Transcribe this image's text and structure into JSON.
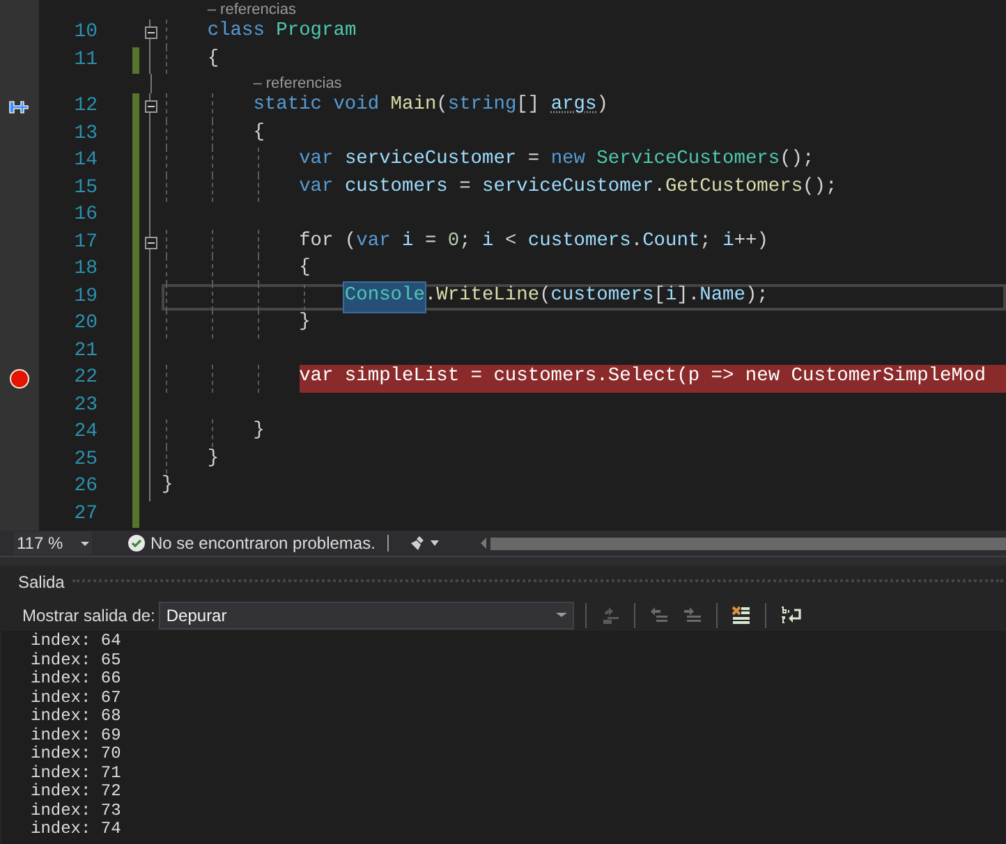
{
  "editor": {
    "lines": [
      {
        "number": "10",
        "lens": "– referencias",
        "fold": true,
        "changed": false,
        "bookmark": false,
        "breakpoint": false,
        "current": false,
        "tokens": [
          {
            "text": "    class ",
            "kind": "keyword"
          },
          {
            "text": "Program",
            "kind": "type"
          }
        ]
      },
      {
        "number": "11",
        "fold": false,
        "changed": true,
        "bookmark": false,
        "breakpoint": false,
        "current": false,
        "tokens": [
          {
            "text": "    {",
            "kind": "plain"
          }
        ]
      },
      {
        "number": "12",
        "lens": "– referencias",
        "fold": true,
        "changed": true,
        "bookmark": true,
        "breakpoint": false,
        "current": false,
        "tokens": [
          {
            "text": "        static void ",
            "kind": "keyword"
          },
          {
            "text": "Main",
            "kind": "method"
          },
          {
            "text": "(",
            "kind": "plain"
          },
          {
            "text": "string",
            "kind": "keyword"
          },
          {
            "text": "[] ",
            "kind": "plain"
          },
          {
            "text": "args",
            "kind": "unused"
          },
          {
            "text": ")",
            "kind": "plain"
          }
        ]
      },
      {
        "number": "13",
        "fold": false,
        "changed": true,
        "bookmark": false,
        "breakpoint": false,
        "current": false,
        "tokens": [
          {
            "text": "        {",
            "kind": "plain"
          }
        ]
      },
      {
        "number": "14",
        "fold": false,
        "changed": true,
        "bookmark": false,
        "breakpoint": false,
        "current": false,
        "tokens": [
          {
            "text": "            var ",
            "kind": "keyword"
          },
          {
            "text": "serviceCustomer",
            "kind": "variable"
          },
          {
            "text": " = ",
            "kind": "plain"
          },
          {
            "text": "new ",
            "kind": "keyword"
          },
          {
            "text": "ServiceCustomers",
            "kind": "type"
          },
          {
            "text": "();",
            "kind": "plain"
          }
        ]
      },
      {
        "number": "15",
        "fold": false,
        "changed": true,
        "bookmark": false,
        "breakpoint": false,
        "current": false,
        "tokens": [
          {
            "text": "            var ",
            "kind": "keyword"
          },
          {
            "text": "customers",
            "kind": "variable"
          },
          {
            "text": " = ",
            "kind": "plain"
          },
          {
            "text": "serviceCustomer",
            "kind": "variable"
          },
          {
            "text": ".",
            "kind": "plain"
          },
          {
            "text": "GetCustomers",
            "kind": "method"
          },
          {
            "text": "();",
            "kind": "plain"
          }
        ]
      },
      {
        "number": "16",
        "fold": false,
        "changed": true,
        "bookmark": false,
        "breakpoint": false,
        "current": false
      },
      {
        "number": "17",
        "fold": true,
        "changed": true,
        "bookmark": false,
        "breakpoint": false,
        "current": false,
        "tokens": [
          {
            "text": "            for (",
            "kind": "plain"
          },
          {
            "text": "var ",
            "kind": "keyword"
          },
          {
            "text": "i",
            "kind": "variable"
          },
          {
            "text": " = ",
            "kind": "plain"
          },
          {
            "text": "0",
            "kind": "number"
          },
          {
            "text": "; ",
            "kind": "plain"
          },
          {
            "text": "i",
            "kind": "variable"
          },
          {
            "text": " < ",
            "kind": "plain"
          },
          {
            "text": "customers",
            "kind": "variable"
          },
          {
            "text": ".",
            "kind": "plain"
          },
          {
            "text": "Count",
            "kind": "variable"
          },
          {
            "text": "; ",
            "kind": "plain"
          },
          {
            "text": "i",
            "kind": "variable"
          },
          {
            "text": "++)",
            "kind": "plain"
          }
        ]
      },
      {
        "number": "18",
        "fold": false,
        "changed": true,
        "bookmark": false,
        "breakpoint": false,
        "current": false,
        "tokens": [
          {
            "text": "            {",
            "kind": "plain"
          }
        ]
      },
      {
        "number": "19",
        "fold": false,
        "changed": true,
        "bookmark": false,
        "breakpoint": false,
        "current": true,
        "tokens": [
          {
            "text": "                Console",
            "kind": "selected-type"
          },
          {
            "text": ".",
            "kind": "plain"
          },
          {
            "text": "WriteLine",
            "kind": "method"
          },
          {
            "text": "(",
            "kind": "plain"
          },
          {
            "text": "customers",
            "kind": "variable"
          },
          {
            "text": "[",
            "kind": "plain"
          },
          {
            "text": "i",
            "kind": "variable"
          },
          {
            "text": "].",
            "kind": "plain"
          },
          {
            "text": "Name",
            "kind": "variable"
          },
          {
            "text": ");",
            "kind": "plain"
          }
        ]
      },
      {
        "number": "20",
        "fold": false,
        "changed": true,
        "bookmark": false,
        "breakpoint": false,
        "current": false,
        "tokens": [
          {
            "text": "            }",
            "kind": "plain"
          }
        ]
      },
      {
        "number": "21",
        "fold": false,
        "changed": true,
        "bookmark": false,
        "breakpoint": false,
        "current": false
      },
      {
        "number": "22",
        "fold": false,
        "changed": true,
        "bookmark": false,
        "breakpoint": true,
        "current": false,
        "tokens": [
          {
            "text": "            var simpleList = customers.Select(p => new CustomerSimpleMod",
            "kind": "plain"
          }
        ]
      },
      {
        "number": "23",
        "fold": false,
        "changed": true,
        "bookmark": false,
        "breakpoint": false,
        "current": false
      },
      {
        "number": "24",
        "fold": false,
        "changed": true,
        "bookmark": false,
        "breakpoint": false,
        "current": false,
        "tokens": [
          {
            "text": "        }",
            "kind": "plain"
          }
        ]
      },
      {
        "number": "25",
        "fold": false,
        "changed": true,
        "bookmark": false,
        "breakpoint": false,
        "current": false,
        "tokens": [
          {
            "text": "    }",
            "kind": "plain"
          }
        ]
      },
      {
        "number": "26",
        "fold": false,
        "changed": true,
        "bookmark": false,
        "breakpoint": false,
        "current": false,
        "tokens": [
          {
            "text": "}",
            "kind": "plain"
          }
        ]
      },
      {
        "number": "27",
        "fold": false,
        "changed": true,
        "bookmark": false,
        "breakpoint": false,
        "current": false
      }
    ]
  },
  "status_bar": {
    "zoom": "117 %",
    "issues": "No se encontraron problemas."
  },
  "output": {
    "title": "Salida",
    "source_label": "Mostrar salida de:",
    "source": "Depurar",
    "lines": [
      "index: 64",
      "index: 65",
      "index: 66",
      "index: 67",
      "index: 68",
      "index: 69",
      "index: 70",
      "index: 71",
      "index: 72",
      "index: 73",
      "index: 74"
    ]
  }
}
